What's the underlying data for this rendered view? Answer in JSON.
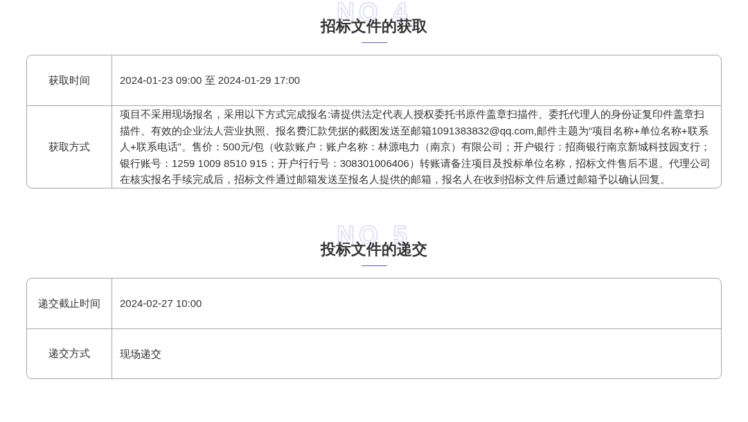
{
  "sections": [
    {
      "number": "NO 4",
      "title": "招标文件的获取",
      "rows": [
        {
          "label": "获取时间",
          "value": "2024-01-23 09:00 至 2024-01-29 17:00"
        },
        {
          "label": "获取方式",
          "value": "项目不采用现场报名，采用以下方式完成报名:请提供法定代表人授权委托书原件盖章扫描件、委托代理人的身份证复印件盖章扫描件、有效的企业法人营业执照、报名费汇款凭据的截图发送至邮箱1091383832@qq.com,邮件主题为“项目名称+单位名称+联系人+联系电话”。售价：500元/包（收款账户：账户名称：林源电力（南京）有限公司；开户银行：招商银行南京新城科技园支行；银行账号：1259 1009 8510 915；开户行行号：308301006406）转账请备注项目及投标单位名称，招标文件售后不退。代理公司在核实报名手续完成后，招标文件通过邮箱发送至报名人提供的邮箱，报名人在收到招标文件后通过邮箱予以确认回复。"
        }
      ]
    },
    {
      "number": "NO 5",
      "title": "投标文件的递交",
      "rows": [
        {
          "label": "递交截止时间",
          "value": "2024-02-27 10:00"
        },
        {
          "label": "递交方式",
          "value": "现场递交"
        }
      ]
    }
  ]
}
